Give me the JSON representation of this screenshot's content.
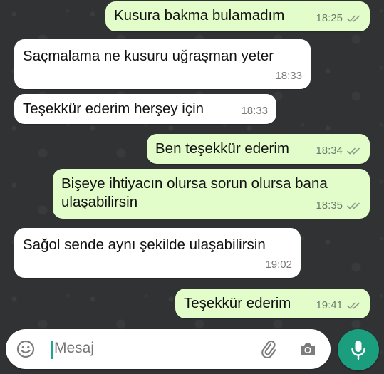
{
  "messages": [
    {
      "text": "Kusura bakma bulamadım",
      "time": "18:25",
      "direction": "out",
      "status": "read"
    },
    {
      "text": "Saçmalama ne kusuru uğraşman yeter",
      "time": "18:33",
      "direction": "in"
    },
    {
      "text": "Teşekkür ederim herşey için",
      "time": "18:33",
      "direction": "in"
    },
    {
      "text": "Ben teşekkür ederim",
      "time": "18:34",
      "direction": "out",
      "status": "read"
    },
    {
      "text": "Bişeye ihtiyacın olursa sorun olursa bana ulaşabilirsin",
      "time": "18:35",
      "direction": "out",
      "status": "read"
    },
    {
      "text": "Sağol sende aynı şekilde ulaşabilirsin",
      "time": "19:02",
      "direction": "in"
    },
    {
      "text": "Teşekkür ederim",
      "time": "19:41",
      "direction": "out",
      "status": "read"
    }
  ],
  "composer": {
    "placeholder": "Mesaj"
  },
  "icons": {
    "emoji": "emoji-icon",
    "attach": "paperclip-icon",
    "camera": "camera-icon",
    "mic": "microphone-icon",
    "check": "double-check-icon"
  },
  "colors": {
    "outgoing_bubble": "#e2fdc9",
    "incoming_bubble": "#ffffff",
    "accent": "#1b9e7d",
    "background": "#303234"
  }
}
